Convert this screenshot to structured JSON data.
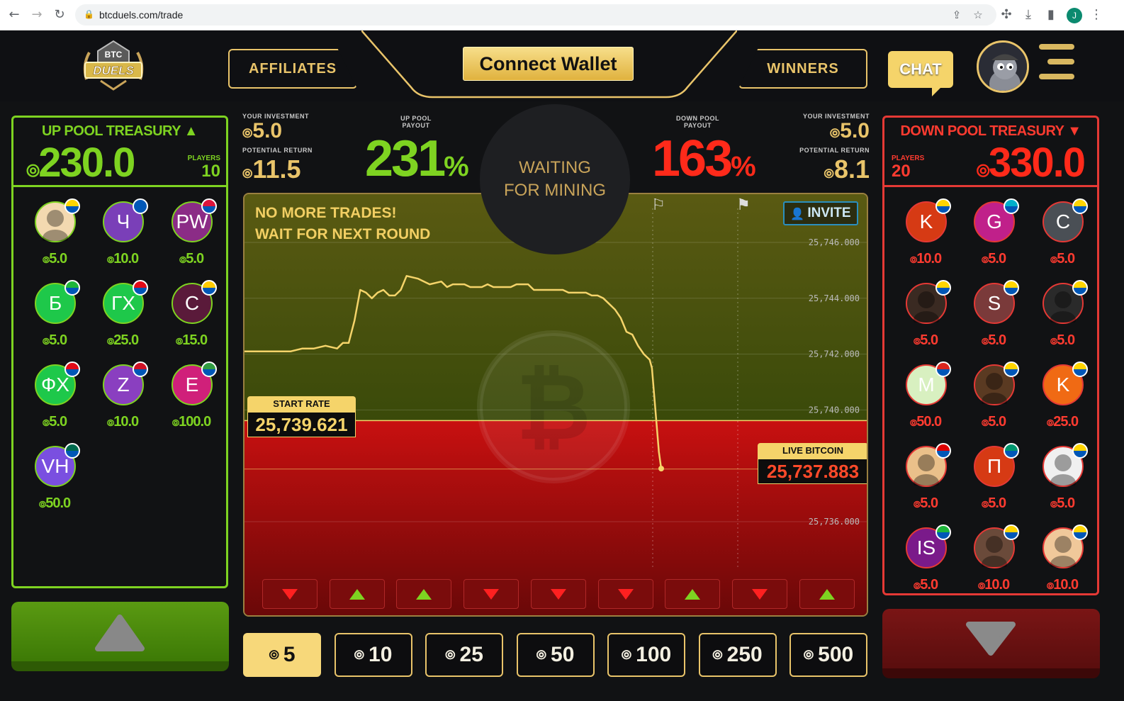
{
  "browser": {
    "url": "btcduels.com/trade",
    "profile_initial": "J"
  },
  "nav": {
    "affiliates": "AFFILIATES",
    "connect": "Connect Wallet",
    "winners": "WINNERS",
    "chat": "CHAT",
    "logo_top": "BTC",
    "logo_bottom": "DUELS"
  },
  "up_pool": {
    "title": "UP POOL TREASURY",
    "amount": "230.0",
    "players_label": "PLAYERS",
    "players": "10",
    "players_list": [
      {
        "initials": "",
        "bet": "5.0",
        "color": "#f3d9b0",
        "flag": "#ffd500",
        "avatar_img": true
      },
      {
        "initials": "Ч",
        "bet": "10.0",
        "color": "#7a3fb8",
        "flag": "#0057b7"
      },
      {
        "initials": "PW",
        "bet": "5.0",
        "color": "#8b2c86",
        "flag": "#dc143c"
      },
      {
        "initials": "Б",
        "bet": "5.0",
        "color": "#1ec84a",
        "flag": "#1eb53a"
      },
      {
        "initials": "ГХ",
        "bet": "25.0",
        "color": "#1ec84a",
        "flag": "#e30a17"
      },
      {
        "initials": "С",
        "bet": "15.0",
        "color": "#5a1a3a",
        "flag": "#fecb00"
      },
      {
        "initials": "ФХ",
        "bet": "5.0",
        "color": "#1ec84a",
        "flag": "#e30a17"
      },
      {
        "initials": "Z",
        "bet": "10.0",
        "color": "#8a3fc0",
        "flag": "#ce1126"
      },
      {
        "initials": "E",
        "bet": "100.0",
        "color": "#d0207a",
        "flag": "#319b42"
      },
      {
        "initials": "VH",
        "bet": "50.0",
        "color": "#7a4fe0",
        "flag": "#006a4e"
      }
    ]
  },
  "down_pool": {
    "title": "DOWN POOL TREASURY",
    "amount": "330.0",
    "players_label": "PLAYERS",
    "players": "20",
    "players_list": [
      {
        "initials": "K",
        "bet": "10.0",
        "color": "#d63a14",
        "flag": "#ffd500"
      },
      {
        "initials": "G",
        "bet": "5.0",
        "color": "#c0208a",
        "flag": "#00afca"
      },
      {
        "initials": "C",
        "bet": "5.0",
        "color": "#4a4f55",
        "flag": "#ffd500"
      },
      {
        "initials": "",
        "bet": "5.0",
        "color": "#3a2a22",
        "flag": "#ffd500",
        "avatar_img": true
      },
      {
        "initials": "S",
        "bet": "5.0",
        "color": "#7a3a3a",
        "flag": "#ffd500"
      },
      {
        "initials": "",
        "bet": "5.0",
        "color": "#2a2a2a",
        "flag": "#ffd500",
        "avatar_img": true
      },
      {
        "initials": "M",
        "bet": "50.0",
        "color": "#d8f0c0",
        "flag": "#da251d"
      },
      {
        "initials": "",
        "bet": "5.0",
        "color": "#5a3a22",
        "flag": "#ffd500",
        "avatar_img": true
      },
      {
        "initials": "K",
        "bet": "25.0",
        "color": "#f06a14",
        "flag": "#ffd500"
      },
      {
        "initials": "",
        "bet": "5.0",
        "color": "#eac08a",
        "flag": "#dd0000",
        "avatar_img": true
      },
      {
        "initials": "П",
        "bet": "5.0",
        "color": "#d63a14",
        "flag": "#00966e"
      },
      {
        "initials": "",
        "bet": "5.0",
        "color": "#f0f0f0",
        "flag": "#ffd500",
        "avatar_img": true
      },
      {
        "initials": "IS",
        "bet": "5.0",
        "color": "#7a1a8a",
        "flag": "#1eb53a"
      },
      {
        "initials": "",
        "bet": "10.0",
        "color": "#6a4a3a",
        "flag": "#ffd500",
        "avatar_img": true
      },
      {
        "initials": "",
        "bet": "10.0",
        "color": "#f0c89a",
        "flag": "#ffd500",
        "avatar_img": true
      }
    ]
  },
  "stats": {
    "your_investment_label": "YOUR INVESTMENT",
    "potential_return_label": "POTENTIAL RETURN",
    "up_investment": "5.0",
    "up_return": "11.5",
    "up_payout_label_1": "UP POOL",
    "up_payout_label_2": "PAYOUT",
    "up_payout": "231",
    "pct": "%",
    "down_payout_label_1": "DOWN POOL",
    "down_payout_label_2": "PAYOUT",
    "down_payout": "163",
    "down_investment": "5.0",
    "down_return": "8.1",
    "waiting": "WAITING FOR MINING"
  },
  "chart": {
    "message_1": "NO MORE TRADES!",
    "message_2": "WAIT FOR NEXT ROUND",
    "invite": "INVITE",
    "start_rate_label": "START RATE",
    "start_rate": "25,739.621",
    "live_label": "LIVE BITCOIN",
    "live_rate": "25,737.883"
  },
  "history": [
    "down",
    "up",
    "up",
    "down",
    "down",
    "down",
    "up",
    "down",
    "up"
  ],
  "amounts": [
    "5",
    "10",
    "25",
    "50",
    "100",
    "250",
    "500"
  ],
  "selected_amount": "5",
  "colors": {
    "up": "#7ed321",
    "down": "#e53935",
    "gold": "#e9c46a"
  },
  "chart_data": {
    "type": "line",
    "ylim": [
      25735.5,
      25746.5
    ],
    "yticks": [
      "25,746.000",
      "25,744.000",
      "25,742.000",
      "25,740.000",
      "25,736.000"
    ],
    "ytick_values": [
      25746,
      25744,
      25742,
      25740,
      25736
    ],
    "x": [
      0,
      10,
      20,
      30,
      40,
      50,
      60,
      70,
      80,
      85,
      90,
      95,
      100,
      105,
      110,
      115,
      120,
      125,
      130,
      135,
      140,
      150,
      160,
      170,
      175,
      180,
      185,
      190,
      195,
      200,
      205,
      210,
      215,
      220,
      225,
      230,
      235,
      240,
      245,
      250,
      255,
      260,
      265,
      270,
      275,
      280,
      285,
      290,
      295,
      300,
      305,
      310,
      315,
      320,
      325,
      330,
      335,
      340,
      345,
      350,
      352,
      355,
      358,
      360
    ],
    "y": [
      25742.1,
      25742.1,
      25742.1,
      25742.1,
      25742.1,
      25742.2,
      25742.2,
      25742.3,
      25742.2,
      25742.4,
      25742.4,
      25743.2,
      25744.3,
      25744.2,
      25744.0,
      25744.2,
      25744.3,
      25744.1,
      25744.1,
      25744.3,
      25744.8,
      25744.7,
      25744.5,
      25744.6,
      25744.4,
      25744.5,
      25744.5,
      25744.5,
      25744.4,
      25744.4,
      25744.4,
      25744.5,
      25744.4,
      25744.4,
      25744.4,
      25744.4,
      25744.5,
      25744.5,
      25744.5,
      25744.3,
      25744.3,
      25744.3,
      25744.3,
      25744.3,
      25744.3,
      25744.2,
      25744.2,
      25744.2,
      25744.2,
      25744.1,
      25744.1,
      25744.0,
      25743.8,
      25743.6,
      25743.3,
      25742.8,
      25742.7,
      25742.3,
      25742.0,
      25741.8,
      25741.5,
      25740.0,
      25738.5,
      25737.9
    ]
  }
}
